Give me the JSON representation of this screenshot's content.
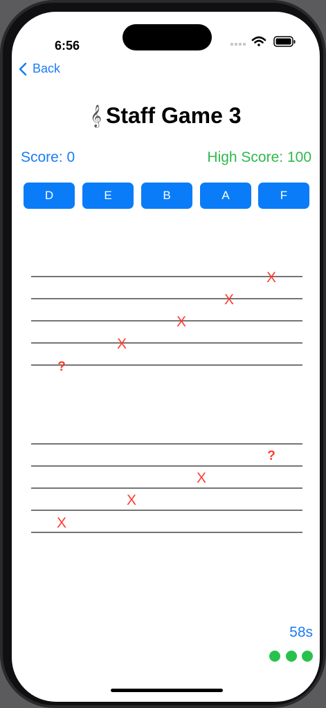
{
  "status_bar": {
    "time": "6:56"
  },
  "nav": {
    "back_label": "Back"
  },
  "game": {
    "clef_glyph": "𝄞",
    "title": "Staff Game 3",
    "score_text": "Score: 0",
    "high_score_text": "High Score: 100",
    "timer_text": "58s"
  },
  "answer_buttons": [
    "D",
    "E",
    "B",
    "A",
    "F"
  ],
  "staff_top": {
    "marks": [
      "?",
      "X",
      "X",
      "X",
      "X"
    ]
  },
  "staff_bottom": {
    "marks": [
      "X",
      "X",
      "X",
      "?"
    ]
  },
  "colors": {
    "accent": "#1a7cf5",
    "button": "#0a7cf8",
    "high_score": "#2fb84d",
    "mark": "#ff3b30",
    "dots": "#27c24c"
  },
  "page_indicator": {
    "count": 3
  }
}
